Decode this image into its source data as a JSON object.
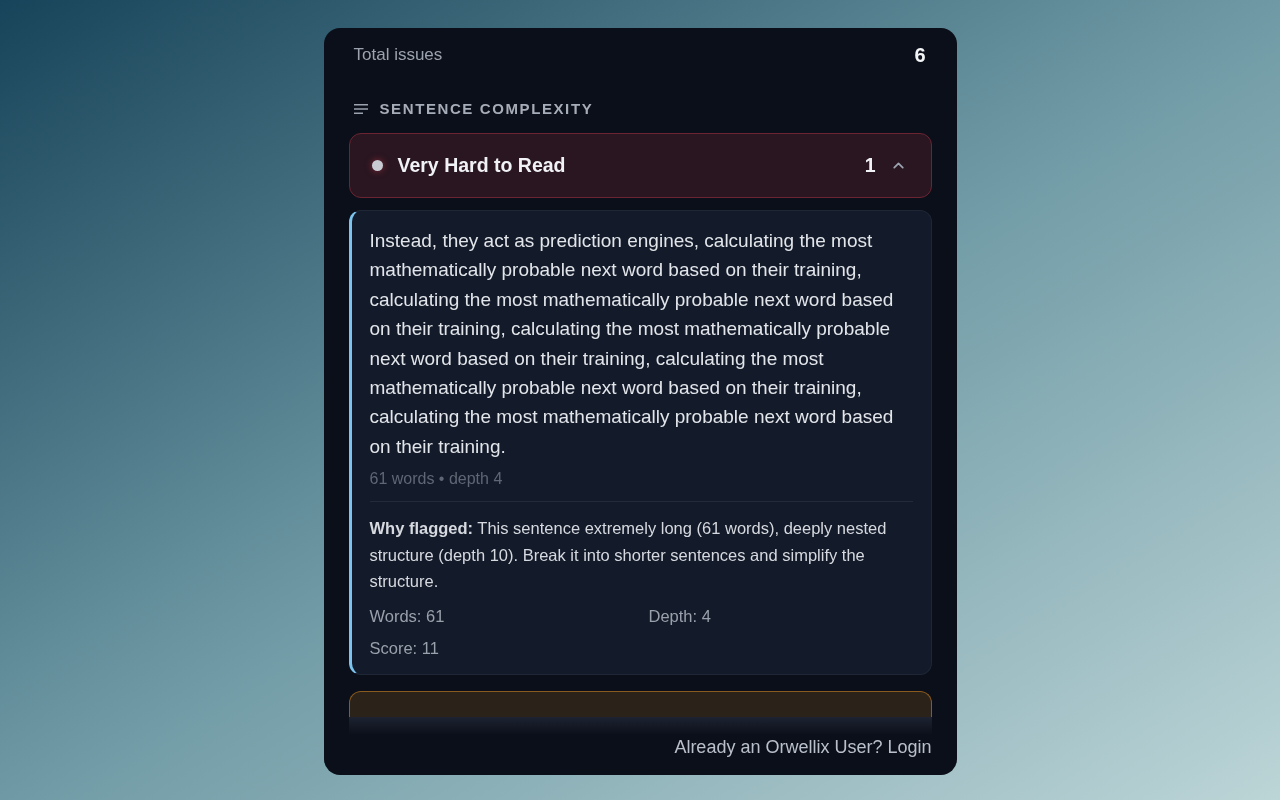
{
  "summary": {
    "label": "Total issues",
    "value": "6"
  },
  "section": {
    "title": "SENTENCE COMPLEXITY"
  },
  "groups": [
    {
      "kind": "full",
      "label": "Very Hard to Read",
      "count": "1",
      "expanded": true,
      "color": "#6b2532",
      "issues": [
        {
          "sentence": "Instead, they act as prediction engines, calculating the most mathematically probable next word based on their training, calculating the most mathematically probable next word based on their training, calculating the most mathematically probable next word based on their training, calculating the most mathematically probable next word based on their training, calculating the most mathematically probable next word based on their training.",
          "meta": "61 words • depth 4",
          "explanation": "**Why flagged:** This sentence extremely long (61 words), deeply nested structure (depth 10). Break it into shorter sentences and simplify the structure.",
          "stats": [
            "Words: 61",
            "Depth: 4",
            "Score: 11"
          ]
        }
      ]
    },
    {
      "kind": "clipped",
      "color": "#8a5a1e"
    }
  ],
  "footer": {
    "prompt": "Already an Orwellix User?",
    "link": "Login"
  }
}
